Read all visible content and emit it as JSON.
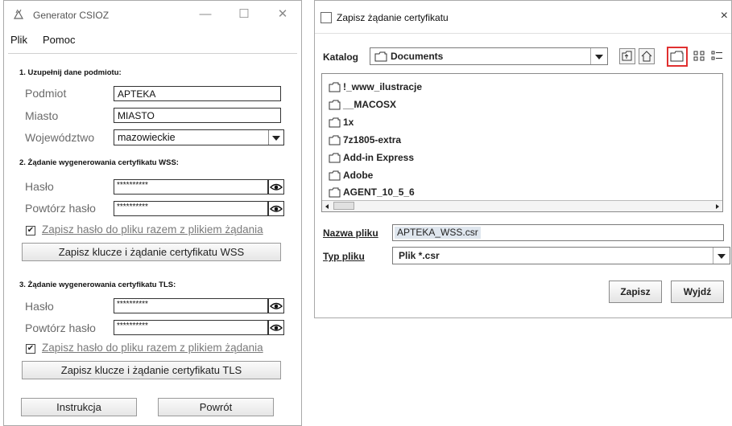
{
  "generator": {
    "title": "Generator CSIOZ",
    "menu": [
      "Plik",
      "Pomoc"
    ],
    "section1": {
      "heading": "1. Uzupełnij dane podmiotu:",
      "podmiot_label": "Podmiot",
      "podmiot_value": "APTEKA",
      "miasto_label": "Miasto",
      "miasto_value": "MIASTO",
      "woj_label": "Województwo",
      "woj_value": "mazowieckie"
    },
    "section2": {
      "heading": "2. Żądanie wygenerowania certyfikatu WSS:",
      "haslo_label": "Hasło",
      "haslo_value": "**********",
      "powtorz_label": "Powtórz hasło",
      "powtorz_value": "**********",
      "checkbox_label": "Zapisz hasło do pliku razem z plikiem żądania",
      "checked": true,
      "save_button": "Zapisz klucze i żądanie certyfikatu WSS"
    },
    "section3": {
      "heading": "3. Żądanie wygenerowania certyfikatu TLS:",
      "haslo_label": "Hasło",
      "haslo_value": "**********",
      "powtorz_label": "Powtórz hasło",
      "powtorz_value": "**********",
      "checkbox_label": "Zapisz hasło do pliku razem z plikiem żądania",
      "checked": true,
      "save_button": "Zapisz klucze i żądanie certyfikatu TLS"
    },
    "buttons": {
      "instrukcja": "Instrukcja",
      "powrot": "Powrót"
    }
  },
  "dialog": {
    "title": "Zapisz żądanie certyfikatu",
    "close": "×",
    "katalog_label": "Katalog",
    "katalog_value": "Documents",
    "toolbar_icons": [
      "up-folder-icon",
      "home-icon",
      "new-folder-icon",
      "list-view-icon",
      "details-view-icon"
    ],
    "highlight_color": "#e03030",
    "files": [
      "!_www_ilustracje",
      "__MACOSX",
      "1x",
      "7z1805-extra",
      "Add-in Express",
      "Adobe",
      "AGENT_10_5_6"
    ],
    "filename_label": "Nazwa pliku",
    "filename_value": "APTEKA_WSS.csr",
    "filetype_label": "Typ pliku",
    "filetype_value": "Plik *.csr",
    "save_button": "Zapisz",
    "exit_button": "Wyjdź"
  }
}
